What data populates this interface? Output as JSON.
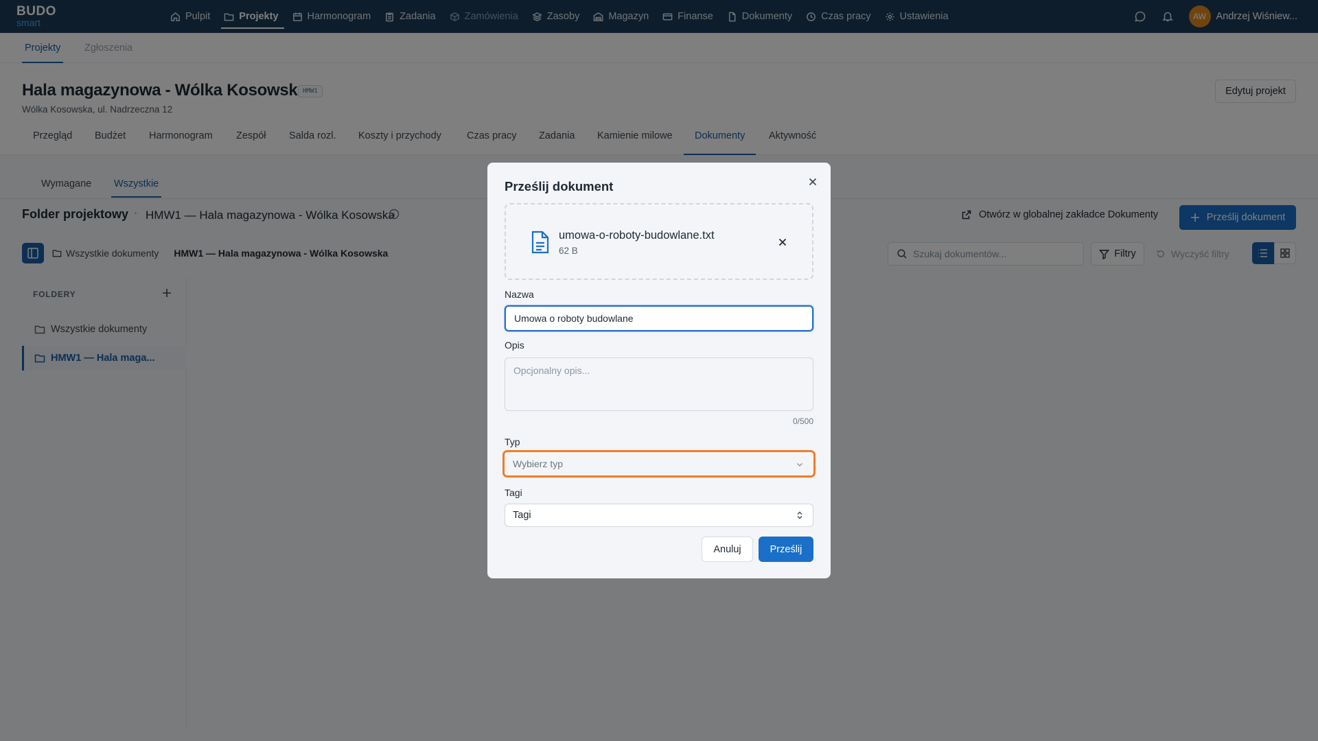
{
  "app": {
    "logo_top": "BUDO",
    "logo_bottom": "smart"
  },
  "topnav": {
    "items": [
      {
        "label": "Pulpit",
        "icon": "home-icon"
      },
      {
        "label": "Projekty",
        "icon": "folder-icon"
      },
      {
        "label": "Harmonogram",
        "icon": "calendar-icon"
      },
      {
        "label": "Zadania",
        "icon": "clipboard-icon"
      },
      {
        "label": "Zamówienia",
        "icon": "box-icon"
      },
      {
        "label": "Zasoby",
        "icon": "layers-icon"
      },
      {
        "label": "Magazyn",
        "icon": "warehouse-icon"
      },
      {
        "label": "Finanse",
        "icon": "wallet-icon"
      },
      {
        "label": "Dokumenty",
        "icon": "document-icon"
      },
      {
        "label": "Czas pracy",
        "icon": "clock-icon"
      },
      {
        "label": "Ustawienia",
        "icon": "gear-icon"
      }
    ],
    "active": "Projekty",
    "user_initials": "AW",
    "user_name": "Andrzej Wiśniew..."
  },
  "subnav": {
    "tabs": [
      "Projekty",
      "Zgłoszenia"
    ],
    "active": "Projekty"
  },
  "project": {
    "title": "Hala magazynowa - Wólka Kosowska",
    "code": "HMW1",
    "address": "Wólka Kosowska, ul. Nadrzeczna 12",
    "edit_label": "Edytuj projekt",
    "tabs": [
      "Przegląd",
      "Budżet",
      "Harmonogram",
      "Zespół",
      "Salda rozl.",
      "Koszty i przychody",
      "Czas pracy",
      "Zadania",
      "Kamienie milowe",
      "Dokumenty",
      "Aktywność"
    ],
    "active_tab": "Dokumenty"
  },
  "documents": {
    "tabs": [
      "Wymagane",
      "Wszystkie"
    ],
    "active_tab": "Wszystkie",
    "folder_title": "Folder projektowy",
    "separator": "·",
    "folder_path": "HMW1 — Hala magazynowa - Wólka Kosowska",
    "open_global": "Otwórz w globalnej zakładce Dokumenty",
    "upload_label": "Prześlij dokument",
    "breadcrumb_root": "Wszystkie dokumenty",
    "breadcrumb_current": "HMW1 — Hala magazynowa - Wólka Kosowska",
    "search_placeholder": "Szukaj dokumentów...",
    "filters_label": "Filtry",
    "clear_label": "Wyczyść filtry",
    "folders_heading": "FOLDERY",
    "folders": [
      "Wszystkie dokumenty",
      "HMW1 — Hala maga..."
    ]
  },
  "modal": {
    "title": "Prześlij dokument",
    "file_name": "umowa-o-roboty-budowlane.txt",
    "file_size": "62 B",
    "name_label": "Nazwa",
    "name_value": "Umowa o roboty budowlane",
    "desc_label": "Opis",
    "desc_placeholder": "Opcjonalny opis...",
    "desc_counter": "0/500",
    "type_label": "Typ",
    "type_placeholder": "Wybierz typ",
    "tags_label": "Tagi",
    "tags_value": "Tagi",
    "cancel_label": "Anuluj",
    "submit_label": "Prześlij"
  },
  "colors": {
    "topbar": "#1a3a57",
    "primary": "#1a6fc9",
    "accent_link": "#1a5fa8",
    "focus_outline": "#f07c2b",
    "avatar": "#e0891f"
  }
}
